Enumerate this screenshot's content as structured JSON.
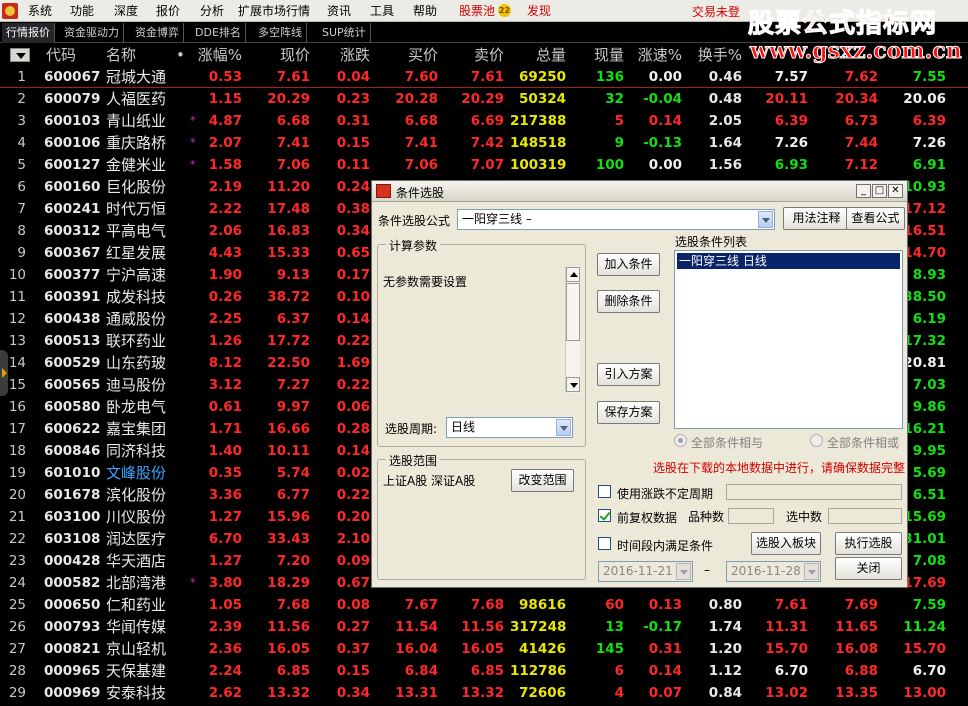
{
  "menu": {
    "items": [
      "系统",
      "功能",
      "深度",
      "报价",
      "分析",
      "扩展市场行情",
      "资讯",
      "工具",
      "帮助"
    ],
    "pool": "股票池",
    "pool_badge": "22",
    "discover": "发现",
    "trade_status": "交易未登"
  },
  "watermark": {
    "title": "股票公式指标网",
    "url": "www.gsxz.com.cn"
  },
  "tabs": [
    "行情报价",
    "资金驱动力",
    "资金博弈",
    "DDE排名",
    "多空阵线",
    "SUP统计"
  ],
  "columns": [
    "代码",
    "名称",
    "•",
    "涨幅%",
    "现价",
    "涨跌",
    "买价",
    "卖价",
    "总量",
    "现量",
    "涨速%",
    "换手%"
  ],
  "rows": [
    {
      "i": "1",
      "code": "600067",
      "name": "冠城大通",
      "mark": "",
      "pct": "0.53",
      "price": "7.61",
      "chg": "0.04",
      "bid": "7.60",
      "ask": "7.61",
      "vol": "69250",
      "cur": "136",
      "spd": "0.00",
      "tur": "0.46",
      "x1": "7.57",
      "x2": "7.62",
      "x3": "7.55"
    },
    {
      "i": "2",
      "code": "600079",
      "name": "人福医药",
      "mark": "",
      "pct": "1.15",
      "price": "20.29",
      "chg": "0.23",
      "bid": "20.28",
      "ask": "20.29",
      "vol": "50324",
      "cur": "32",
      "spd": "-0.04",
      "tur": "0.48",
      "x1": "20.11",
      "x2": "20.34",
      "x3": "20.06"
    },
    {
      "i": "3",
      "code": "600103",
      "name": "青山纸业",
      "mark": "*",
      "pct": "4.87",
      "price": "6.68",
      "chg": "0.31",
      "bid": "6.68",
      "ask": "6.69",
      "vol": "217388",
      "cur": "5",
      "spd": "0.14",
      "tur": "2.05",
      "x1": "6.39",
      "x2": "6.73",
      "x3": "6.39"
    },
    {
      "i": "4",
      "code": "600106",
      "name": "重庆路桥",
      "mark": "*",
      "pct": "2.07",
      "price": "7.41",
      "chg": "0.15",
      "bid": "7.41",
      "ask": "7.42",
      "vol": "148518",
      "cur": "9",
      "spd": "-0.13",
      "tur": "1.64",
      "x1": "7.26",
      "x2": "7.44",
      "x3": "7.26"
    },
    {
      "i": "5",
      "code": "600127",
      "name": "金健米业",
      "mark": "*",
      "pct": "1.58",
      "price": "7.06",
      "chg": "0.11",
      "bid": "7.06",
      "ask": "7.07",
      "vol": "100319",
      "cur": "100",
      "spd": "0.00",
      "tur": "1.56",
      "x1": "6.93",
      "x2": "7.12",
      "x3": "6.91"
    },
    {
      "i": "6",
      "code": "600160",
      "name": "巨化股份",
      "mark": "",
      "pct": "2.19",
      "price": "11.20",
      "chg": "0.24",
      "x3": "10.93"
    },
    {
      "i": "7",
      "code": "600241",
      "name": "时代万恒",
      "mark": "",
      "pct": "2.22",
      "price": "17.48",
      "chg": "0.38",
      "x3": "17.12"
    },
    {
      "i": "8",
      "code": "600312",
      "name": "平高电气",
      "mark": "",
      "pct": "2.06",
      "price": "16.83",
      "chg": "0.34",
      "x3": "16.51"
    },
    {
      "i": "9",
      "code": "600367",
      "name": "红星发展",
      "mark": "",
      "pct": "4.43",
      "price": "15.33",
      "chg": "0.65",
      "x3": "14.70"
    },
    {
      "i": "10",
      "code": "600377",
      "name": "宁沪高速",
      "mark": "",
      "pct": "1.90",
      "price": "9.13",
      "chg": "0.17",
      "x3": "8.93"
    },
    {
      "i": "11",
      "code": "600391",
      "name": "成发科技",
      "mark": "",
      "pct": "0.26",
      "price": "38.72",
      "chg": "0.10",
      "x3": "38.50"
    },
    {
      "i": "12",
      "code": "600438",
      "name": "通威股份",
      "mark": "",
      "pct": "2.25",
      "price": "6.37",
      "chg": "0.14",
      "x3": "6.19"
    },
    {
      "i": "13",
      "code": "600513",
      "name": "联环药业",
      "mark": "",
      "pct": "1.26",
      "price": "17.72",
      "chg": "0.22",
      "x3": "17.32"
    },
    {
      "i": "14",
      "code": "600529",
      "name": "山东药玻",
      "mark": "",
      "pct": "8.12",
      "price": "22.50",
      "chg": "1.69",
      "x3": "20.81"
    },
    {
      "i": "15",
      "code": "600565",
      "name": "迪马股份",
      "mark": "",
      "pct": "3.12",
      "price": "7.27",
      "chg": "0.22",
      "x3": "7.03"
    },
    {
      "i": "16",
      "code": "600580",
      "name": "卧龙电气",
      "mark": "",
      "pct": "0.61",
      "price": "9.97",
      "chg": "0.06",
      "x3": "9.86"
    },
    {
      "i": "17",
      "code": "600622",
      "name": "嘉宝集团",
      "mark": "",
      "pct": "1.71",
      "price": "16.66",
      "chg": "0.28",
      "x3": "16.21"
    },
    {
      "i": "18",
      "code": "600846",
      "name": "同济科技",
      "mark": "",
      "pct": "1.40",
      "price": "10.11",
      "chg": "0.14",
      "x3": "9.95"
    },
    {
      "i": "19",
      "code": "601010",
      "name": "文峰股份",
      "mark": "",
      "pct": "0.35",
      "price": "5.74",
      "chg": "0.02",
      "x3": "5.69"
    },
    {
      "i": "20",
      "code": "601678",
      "name": "滨化股份",
      "mark": "",
      "pct": "3.36",
      "price": "6.77",
      "chg": "0.22",
      "x3": "6.51"
    },
    {
      "i": "21",
      "code": "603100",
      "name": "川仪股份",
      "mark": "",
      "pct": "1.27",
      "price": "15.96",
      "chg": "0.20",
      "x3": "15.69"
    },
    {
      "i": "22",
      "code": "603108",
      "name": "润达医疗",
      "mark": "",
      "pct": "6.70",
      "price": "33.43",
      "chg": "2.10",
      "x3": "31.01"
    },
    {
      "i": "23",
      "code": "000428",
      "name": "华天酒店",
      "mark": "",
      "pct": "1.27",
      "price": "7.20",
      "chg": "0.09",
      "x3": "7.08"
    },
    {
      "i": "24",
      "code": "000582",
      "name": "北部湾港",
      "mark": "*",
      "pct": "3.80",
      "price": "18.29",
      "chg": "0.67",
      "x3": "17.69"
    },
    {
      "i": "25",
      "code": "000650",
      "name": "仁和药业",
      "mark": "",
      "pct": "1.05",
      "price": "7.68",
      "chg": "0.08",
      "bid": "7.67",
      "ask": "7.68",
      "vol": "98616",
      "cur": "60",
      "spd": "0.13",
      "tur": "0.80",
      "x1": "7.61",
      "x2": "7.69",
      "x3": "7.59"
    },
    {
      "i": "26",
      "code": "000793",
      "name": "华闻传媒",
      "mark": "",
      "pct": "2.39",
      "price": "11.56",
      "chg": "0.27",
      "bid": "11.54",
      "ask": "11.56",
      "vol": "317248",
      "cur": "13",
      "spd": "-0.17",
      "tur": "1.74",
      "x1": "11.31",
      "x2": "11.65",
      "x3": "11.24"
    },
    {
      "i": "27",
      "code": "000821",
      "name": "京山轻机",
      "mark": "",
      "pct": "2.36",
      "price": "16.05",
      "chg": "0.37",
      "bid": "16.04",
      "ask": "16.05",
      "vol": "41426",
      "cur": "145",
      "spd": "0.31",
      "tur": "1.20",
      "x1": "15.70",
      "x2": "16.08",
      "x3": "15.70"
    },
    {
      "i": "28",
      "code": "000965",
      "name": "天保基建",
      "mark": "",
      "pct": "2.24",
      "price": "6.85",
      "chg": "0.15",
      "bid": "6.84",
      "ask": "6.85",
      "vol": "112786",
      "cur": "6",
      "spd": "0.14",
      "tur": "1.12",
      "x1": "6.70",
      "x2": "6.88",
      "x3": "6.70"
    },
    {
      "i": "29",
      "code": "000969",
      "name": "安泰科技",
      "mark": "",
      "pct": "2.62",
      "price": "13.32",
      "chg": "0.34",
      "bid": "13.31",
      "ask": "13.32",
      "vol": "72606",
      "cur": "4",
      "spd": "0.07",
      "tur": "0.84",
      "x1": "13.02",
      "x2": "13.35",
      "x3": "13.00"
    }
  ],
  "dialog": {
    "title": "条件选股",
    "formula_label": "条件选股公式",
    "formula_value": "一阳穿三线  –",
    "usage_button": "用法注释",
    "view_formula_button": "查看公式",
    "params_group": "计算参数",
    "no_params_text": "无参数需要设置",
    "period_label": "选股周期:",
    "period_value": "日线",
    "add_button": "加入条件",
    "delete_button": "删除条件",
    "import_button": "引入方案",
    "save_button": "保存方案",
    "list_label": "选股条件列表",
    "list_items": [
      "一阳穿三线   日线"
    ],
    "radio_and": "全部条件相与",
    "radio_or": "全部条件相或",
    "range_group": "选股范围",
    "range_value": "上证A股 深证A股",
    "change_range_button": "改变范围",
    "warning_text": "选股在下载的本地数据中进行，请确保数据完整",
    "use_unstable_label": "使用涨跌不定周期",
    "fuquan_label": "前复权数据",
    "varieties_label": "品种数",
    "selected_label": "选中数",
    "time_range_label": "时间段内满足条件",
    "to_board_button": "选股入板块",
    "execute_button": "执行选股",
    "date_from": "2016-11-21",
    "date_dash": "–",
    "date_to": "2016-11-28",
    "close_button": "关闭"
  }
}
